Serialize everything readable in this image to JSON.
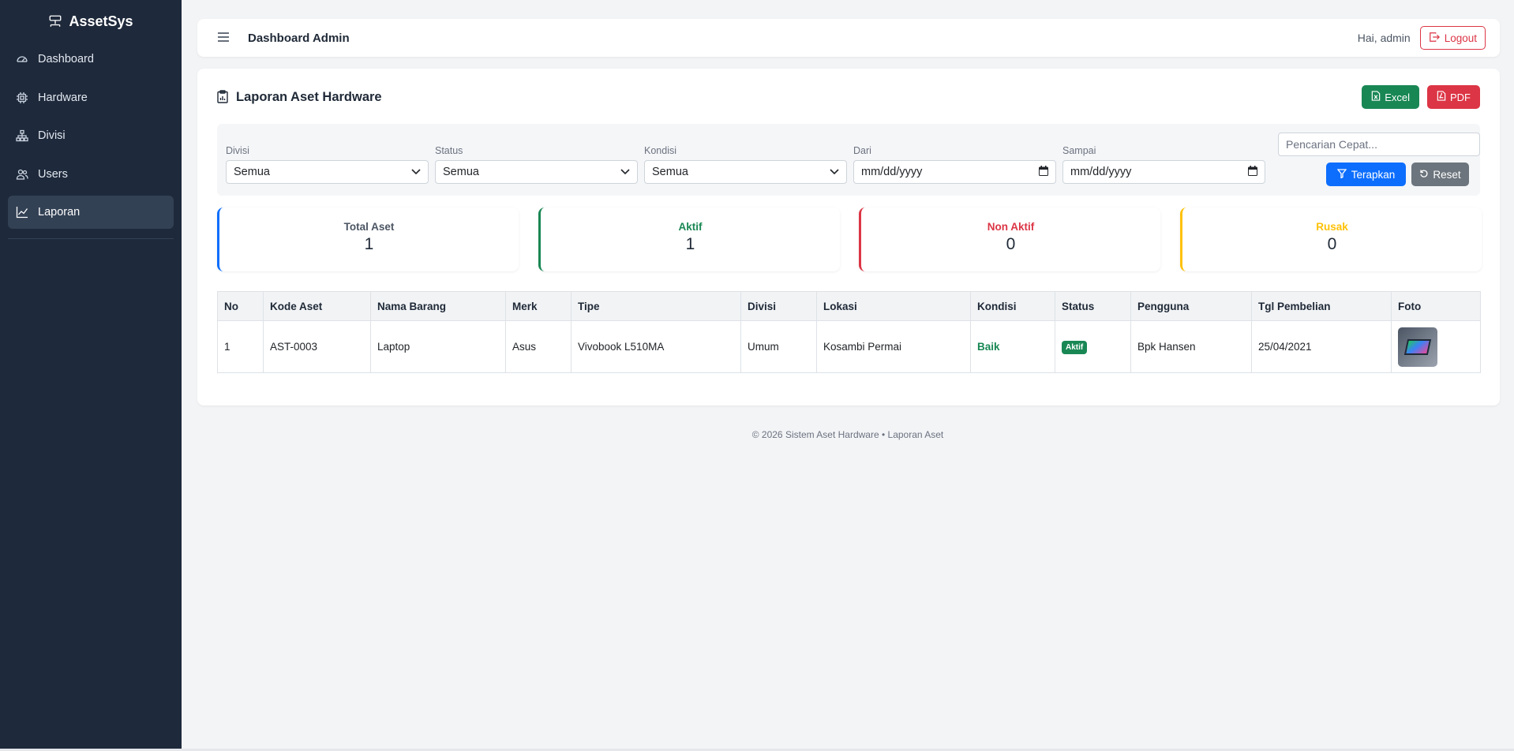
{
  "sidebar": {
    "brand": "AssetSys",
    "items": [
      {
        "label": "Dashboard",
        "icon": "speedometer-icon"
      },
      {
        "label": "Hardware",
        "icon": "cpu-icon"
      },
      {
        "label": "Divisi",
        "icon": "diagram-icon"
      },
      {
        "label": "Users",
        "icon": "users-icon"
      },
      {
        "label": "Laporan",
        "icon": "graph-icon",
        "active": true
      }
    ]
  },
  "topbar": {
    "title": "Dashboard Admin",
    "greeting": "Hai, admin",
    "logout_label": "Logout"
  },
  "report": {
    "title": "Laporan Aset Hardware",
    "excel_label": "Excel",
    "pdf_label": "PDF"
  },
  "filters": {
    "divisi": {
      "label": "Divisi",
      "value": "Semua"
    },
    "status": {
      "label": "Status",
      "value": "Semua"
    },
    "kondisi": {
      "label": "Kondisi",
      "value": "Semua"
    },
    "dari": {
      "label": "Dari",
      "value": "mm/dd/yyyy"
    },
    "sampai": {
      "label": "Sampai",
      "value": "mm/dd/yyyy"
    },
    "search_placeholder": "Pencarian Cepat...",
    "apply_label": "Terapkan",
    "reset_label": "Reset"
  },
  "stats": {
    "total": {
      "label": "Total Aset",
      "value": "1",
      "color": "#0d6efd"
    },
    "aktif": {
      "label": "Aktif",
      "value": "1",
      "color": "#198754"
    },
    "nonaktif": {
      "label": "Non Aktif",
      "value": "0",
      "color": "#dc3545"
    },
    "rusak": {
      "label": "Rusak",
      "value": "0",
      "color": "#ffc107"
    }
  },
  "table": {
    "headers": [
      "No",
      "Kode Aset",
      "Nama Barang",
      "Merk",
      "Tipe",
      "Divisi",
      "Lokasi",
      "Kondisi",
      "Status",
      "Pengguna",
      "Tgl Pembelian",
      "Foto"
    ],
    "rows": [
      {
        "no": "1",
        "kode": "AST-0003",
        "nama": "Laptop",
        "merk": "Asus",
        "tipe": "Vivobook L510MA",
        "divisi": "Umum",
        "lokasi": "Kosambi Permai",
        "kondisi": "Baik",
        "status": "Aktif",
        "pengguna": "Bpk Hansen",
        "tgl": "25/04/2021",
        "foto": "laptop-photo"
      }
    ]
  },
  "footer": "© 2026 Sistem Aset Hardware • Laporan Aset"
}
